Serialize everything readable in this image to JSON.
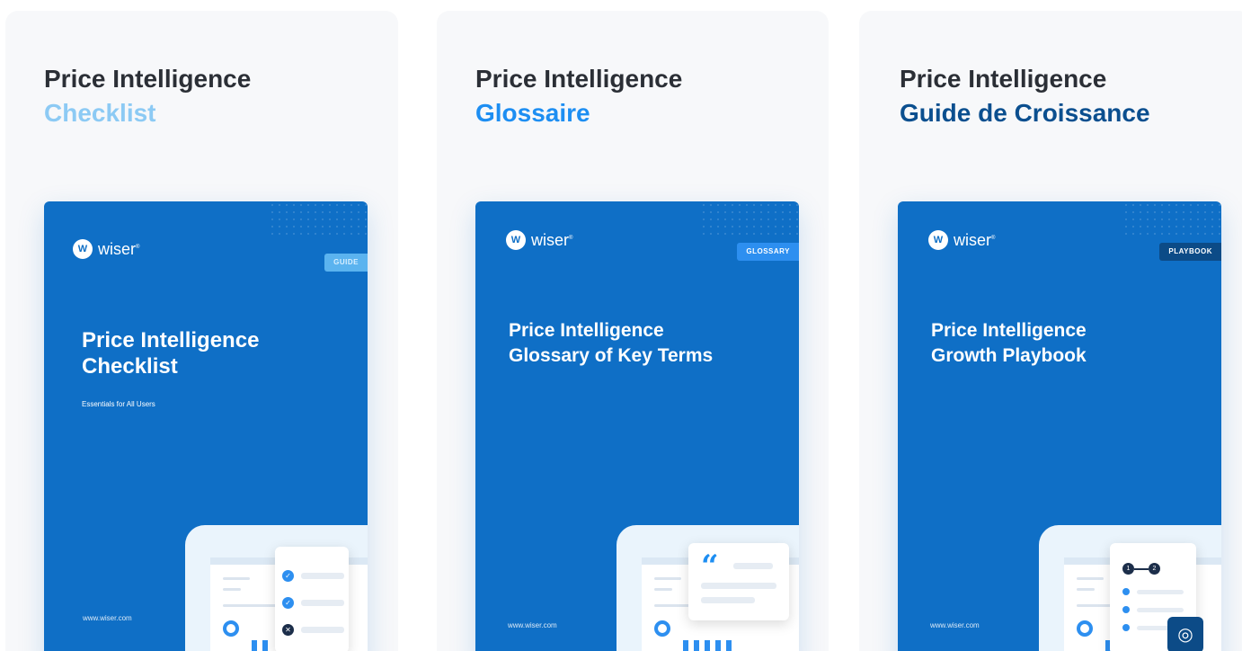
{
  "cards": [
    {
      "title_line1": "Price Intelligence",
      "title_line2": "Checklist",
      "accent": "#8ccaf4",
      "cover": {
        "logo": "wiser",
        "tag": "GUIDE",
        "title_line1": "Price Intelligence",
        "title_line2": "Checklist",
        "subtitle": "Essentials for All Users",
        "url": "www.wiser.com",
        "illustration": "checklist-panel"
      }
    },
    {
      "title_line1": "Price Intelligence",
      "title_line2": "Glossaire",
      "accent": "#1d8ef2",
      "cover": {
        "logo": "wiser",
        "tag": "GLOSSARY",
        "title_line1": "Price Intelligence",
        "title_line2": "Glossary of Key Terms",
        "url": "www.wiser.com",
        "illustration": "quote-panel"
      }
    },
    {
      "title_line1": "Price Intelligence",
      "title_line2": "Guide de Croissance",
      "accent": "#0b4f8f",
      "cover": {
        "logo": "wiser",
        "tag": "PLAYBOOK",
        "title_line1": "Price Intelligence",
        "title_line2": "Growth Playbook",
        "url": "www.wiser.com",
        "illustration": "steps-panel"
      }
    }
  ],
  "colors": {
    "cover_blue": "#0f6fc6",
    "card_bg": "#f7f8fa"
  }
}
